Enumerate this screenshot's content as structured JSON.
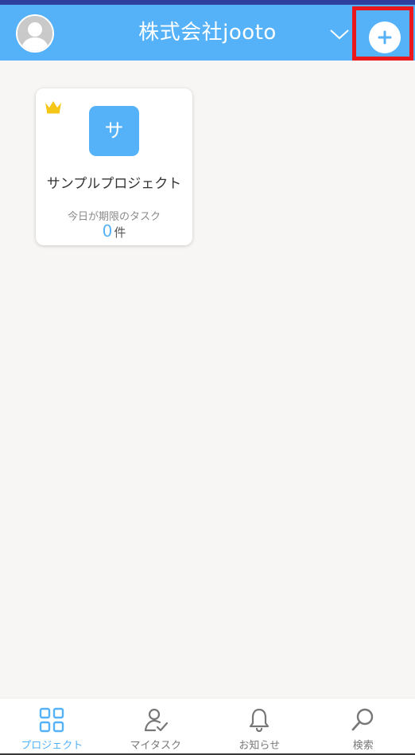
{
  "header": {
    "title": "株式会社jooto"
  },
  "project_card": {
    "icon_letter": "サ",
    "name": "サンプルプロジェクト",
    "due_today_label": "今日が期限のタスク",
    "due_today_count": "0",
    "due_today_unit": "件"
  },
  "bottom_nav": {
    "items": [
      {
        "label": "プロジェクト",
        "icon": "grid-icon",
        "active": true
      },
      {
        "label": "マイタスク",
        "icon": "user-check-icon",
        "active": false
      },
      {
        "label": "お知らせ",
        "icon": "bell-icon",
        "active": false
      },
      {
        "label": "検索",
        "icon": "search-icon",
        "active": false
      }
    ]
  },
  "colors": {
    "accent": "#55b2f8",
    "highlight": "#e8181c",
    "crown": "#f5c518",
    "top_strip": "#2f3f9e"
  }
}
